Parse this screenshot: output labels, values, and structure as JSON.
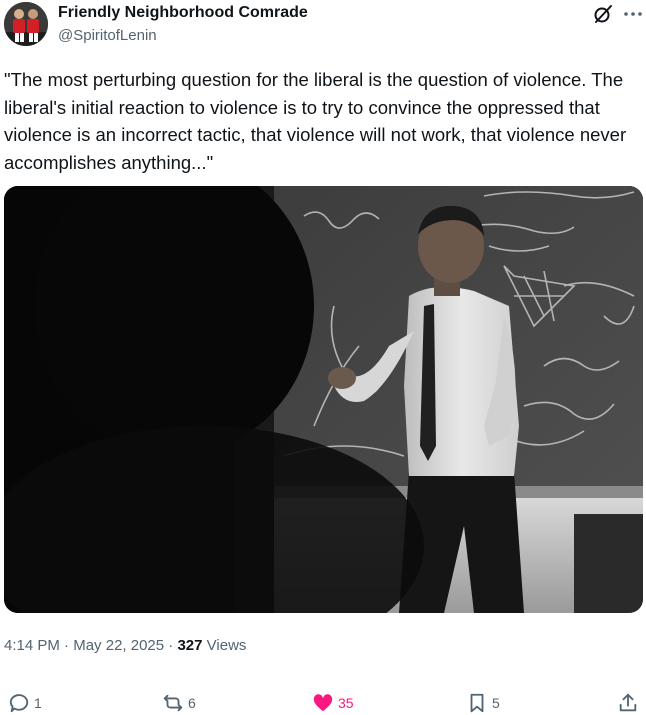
{
  "author": {
    "display_name": "Friendly Neighborhood Comrade",
    "handle": "@SpiritofLenin"
  },
  "tweet": {
    "text": "\"The most perturbing question for the liberal is the question of violence. The liberal's initial reaction to violence is to try to convince the oppressed that violence is an incorrect tactic, that violence will not work, that violence never accomplishes anything...\""
  },
  "meta": {
    "time": "4:14 PM",
    "separator": "·",
    "date": "May 22, 2025",
    "views_count": "327",
    "views_label": "Views"
  },
  "actions": {
    "replies": "1",
    "reposts": "6",
    "likes": "35",
    "bookmarks": "5"
  },
  "icons": {
    "grok": "grok-icon",
    "more": "more-icon",
    "reply": "reply-icon",
    "repost": "repost-icon",
    "like": "heart-icon",
    "bookmark": "bookmark-icon",
    "share": "share-icon"
  },
  "colors": {
    "text": "#0f1419",
    "secondary": "#536471",
    "like": "#f91880"
  }
}
